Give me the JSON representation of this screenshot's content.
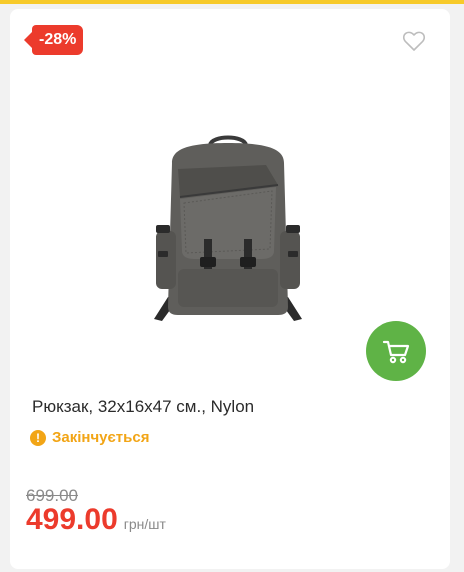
{
  "badge": {
    "discount": "-28%"
  },
  "product": {
    "title": "Рюкзак, 32x16x47 см., Nylon",
    "stock_status": "Закінчується",
    "old_price": "699.00",
    "price": "499.00",
    "unit": "грн/шт"
  },
  "icons": {
    "favorite": "heart-outline-icon",
    "cart": "cart-icon",
    "stock": "exclamation-icon"
  },
  "colors": {
    "accent_red": "#ec3b2c",
    "cart_green": "#5fb346",
    "stock_orange": "#f2a516",
    "top_strip": "#f7ca2a"
  }
}
